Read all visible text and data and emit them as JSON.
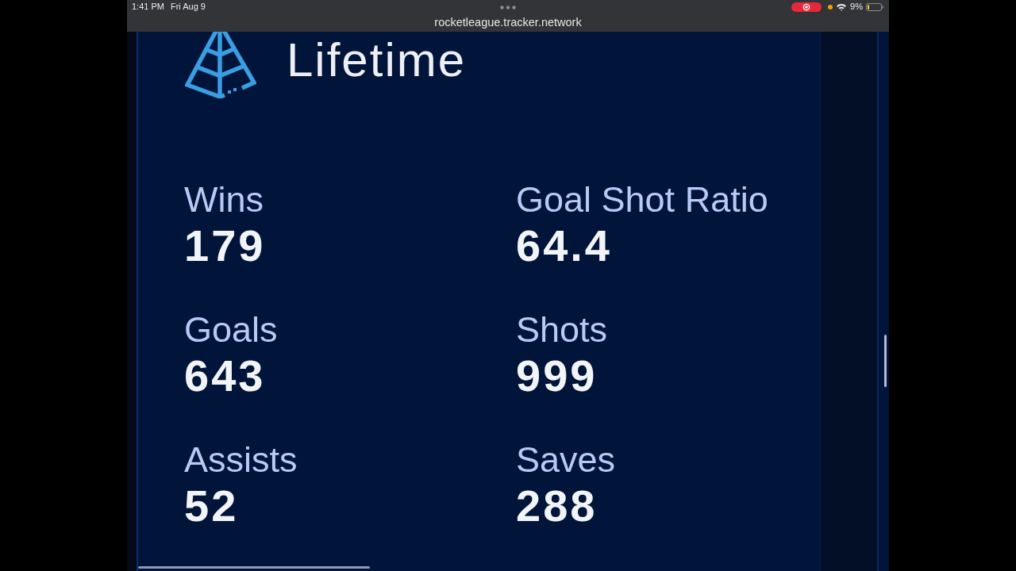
{
  "status_bar": {
    "time": "1:41 PM",
    "date": "Fri Aug 9",
    "url": "rocketleague.tracker.network",
    "battery": "9%"
  },
  "section": {
    "title": "Lifetime",
    "stats": [
      {
        "label": "Wins",
        "value": "179"
      },
      {
        "label": "Goal Shot Ratio",
        "value": "64.4"
      },
      {
        "label": "Goals",
        "value": "643"
      },
      {
        "label": "Shots",
        "value": "999"
      },
      {
        "label": "Assists",
        "value": "52"
      },
      {
        "label": "Saves",
        "value": "288"
      }
    ]
  }
}
